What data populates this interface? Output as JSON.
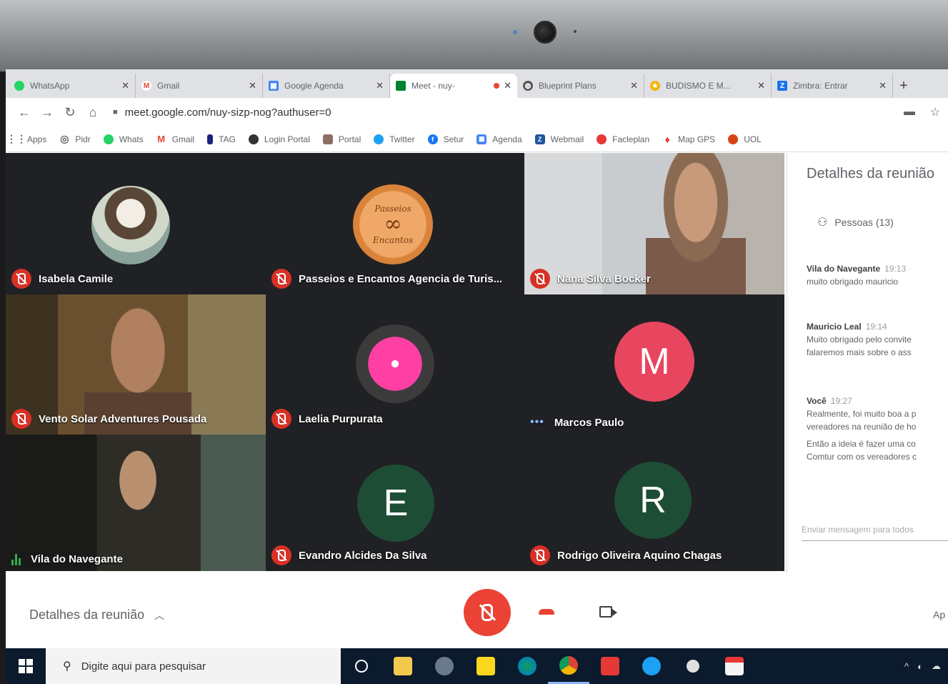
{
  "browser": {
    "tabs": [
      {
        "title": "WhatsApp",
        "color": "#25d366",
        "icon": "whatsapp-icon"
      },
      {
        "title": "Gmail",
        "color": "#ea4335",
        "icon": "gmail-icon"
      },
      {
        "title": "Google Agenda",
        "color": "#4285f4",
        "icon": "calendar-icon"
      },
      {
        "title": "Meet - nuy-",
        "color": "#00832d",
        "icon": "meet-icon",
        "active": true
      },
      {
        "title": "Blueprint Plans",
        "color": "#555555",
        "icon": "globe-icon"
      },
      {
        "title": "BUDISMO E M...",
        "color": "#f4b400",
        "icon": "star-icon"
      },
      {
        "title": "Zimbra: Entrar",
        "color": "#1a73e8",
        "icon": "zimbra-icon"
      }
    ],
    "url": "meet.google.com/nuy-sizp-nog?authuser=0",
    "bookmarks": [
      {
        "label": "Apps",
        "color": "#5f6368"
      },
      {
        "label": "Pidr",
        "color": "#5f6368"
      },
      {
        "label": "Whats",
        "color": "#25d366"
      },
      {
        "label": "Gmail",
        "color": "#ea4335"
      },
      {
        "label": "TAG",
        "color": "#1a237e"
      },
      {
        "label": "Login Portal",
        "color": "#333333"
      },
      {
        "label": "Portal",
        "color": "#8d6e63"
      },
      {
        "label": "Twitter",
        "color": "#1da1f2"
      },
      {
        "label": "Setur",
        "color": "#1877f2"
      },
      {
        "label": "Agenda",
        "color": "#4285f4"
      },
      {
        "label": "Webmail",
        "color": "#1e56a0"
      },
      {
        "label": "Facleplan",
        "color": "#e53935"
      },
      {
        "label": "Map GPS",
        "color": "#e53935"
      },
      {
        "label": "UOL",
        "color": "#d84315"
      }
    ]
  },
  "participants": [
    {
      "name": "Isabela Camile",
      "status": "muted"
    },
    {
      "name": "Passeios e Encantos Agencia de Turis...",
      "status": "muted"
    },
    {
      "name": "Nana Silva Bocker",
      "status": "muted"
    },
    {
      "name": "Vento Solar Adventures Pousada",
      "status": "muted"
    },
    {
      "name": "Laelia Purpurata",
      "status": "muted"
    },
    {
      "name": "Marcos Paulo",
      "status": "connecting",
      "initial": "M",
      "color": "#e8455f"
    },
    {
      "name": "Vila do Navegante",
      "status": "speaking"
    },
    {
      "name": "Evandro Alcides Da Silva",
      "status": "muted",
      "initial": "E",
      "color": "#1e4d35"
    },
    {
      "name": "Rodrigo Oliveira Aquino Chagas",
      "status": "muted",
      "initial": "R",
      "color": "#1e4d35"
    }
  ],
  "logo_text": {
    "top": "Passeios",
    "bottom": "Encantos"
  },
  "sidebar": {
    "title": "Detalhes da reunião",
    "people_label": "Pessoas (13)",
    "messages": [
      {
        "sender": "Vila do Navegante",
        "time": "19:13",
        "lines": [
          "muito obrigado mauricio"
        ]
      },
      {
        "sender": "Mauricio Leal",
        "time": "19:14",
        "lines": [
          "Muito obrigado pelo convite",
          "falaremos mais sobre o ass"
        ]
      },
      {
        "sender": "Você",
        "time": "19:27",
        "lines": [
          "Realmente, foi muito boa a p",
          "vereadores na reunião de ho",
          "Então a ideia é fazer uma co",
          "Comtur com os vereadores c"
        ]
      }
    ],
    "input_placeholder": "Enviar mensagem para todos"
  },
  "controls": {
    "details_label": "Detalhes da reunião",
    "right_label": "Ap"
  },
  "taskbar": {
    "search_placeholder": "Digite aqui para pesquisar",
    "apps": [
      {
        "name": "cortana",
        "color": "#0b1a2d"
      },
      {
        "name": "file-explorer",
        "color": "#f2c94c"
      },
      {
        "name": "settings-gear",
        "color": "#6b7a8a"
      },
      {
        "name": "sticky-notes",
        "color": "#f9d71c"
      },
      {
        "name": "edge",
        "color": "#0f9d58"
      },
      {
        "name": "chrome",
        "color": "#db4437",
        "active": true
      },
      {
        "name": "office",
        "color": "#e53935"
      },
      {
        "name": "skype",
        "color": "#1da1f2"
      },
      {
        "name": "settings",
        "color": "#e0e0e0"
      },
      {
        "name": "pdf",
        "color": "#f5f5f5"
      }
    ]
  }
}
